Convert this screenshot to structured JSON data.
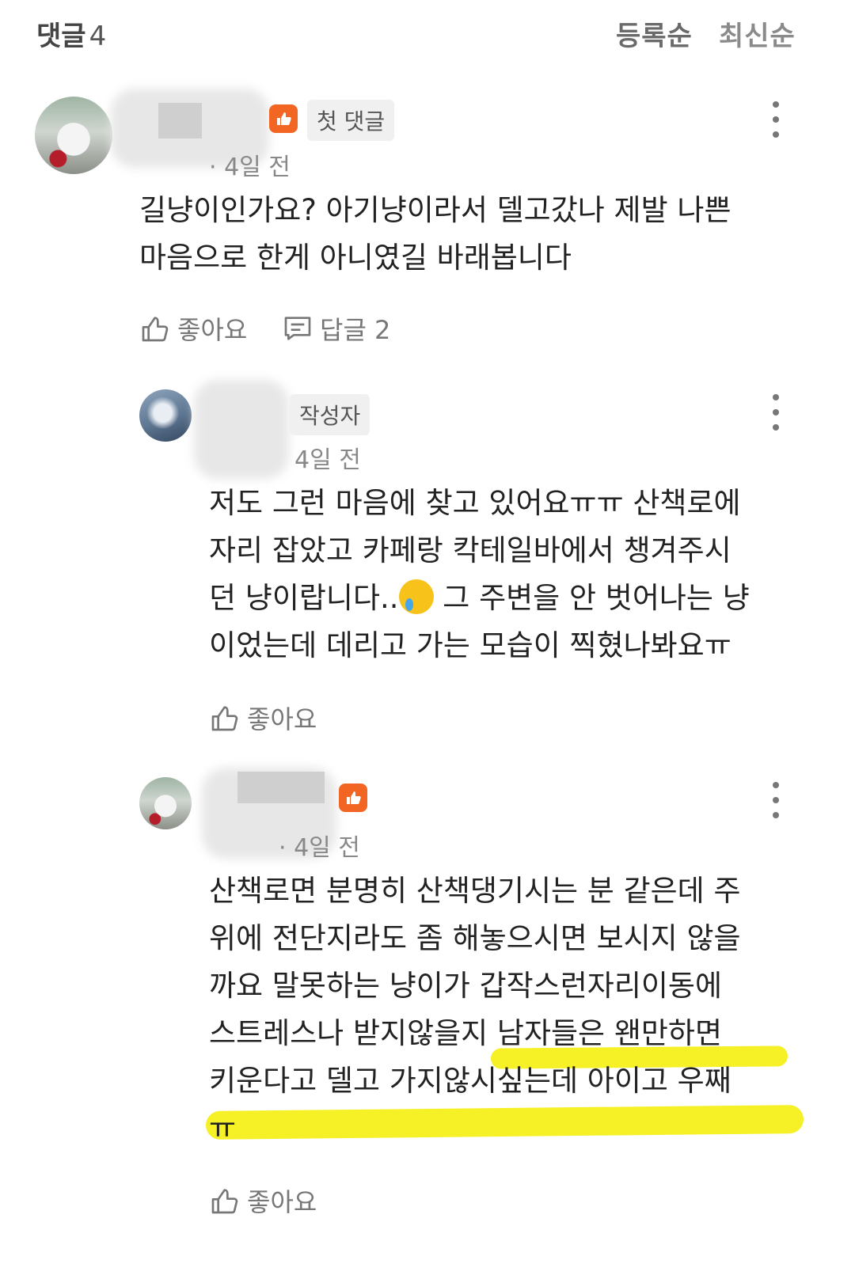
{
  "header": {
    "title": "댓글",
    "count": "4",
    "sort_options": [
      "등록순",
      "최신순"
    ]
  },
  "comments": [
    {
      "badge_tag": "첫 댓글",
      "time": "· 4일 전",
      "text_lines": [
        "길냥이인가요? 아기냥이라서 델고갔나 제발 나쁜",
        "마음으로 한게 아니였길 바래봅니다"
      ],
      "like_label": "좋아요",
      "reply_label": "답글 2"
    },
    {
      "badge_tag": "작성자",
      "time": "4일 전",
      "text_lines": [
        "저도 그런 마음에 찾고 있어요ㅠㅠ 산책로에",
        "자리 잡았고 카페랑 칵테일바에서 챙겨주시",
        "던 냥이랍니다..",
        " 그 주변을 안 벗어나는 냥",
        "이었는데 데리고 가는 모습이 찍혔나봐요ㅠ"
      ],
      "like_label": "좋아요"
    },
    {
      "time": "· 4일 전",
      "text_lines": [
        "산책로면 분명히 산책댕기시는 분 같은데 주",
        "위에 전단지라도 좀 해놓으시면 보시지 않을",
        "까요 말못하는 냥이가 갑작스런자리이동에",
        "스트레스나 받지않을지 남자들은 왠만하면",
        "키운다고 델고 가지않시싶는데 아이고 우째",
        "ㅠ"
      ],
      "like_label": "좋아요"
    }
  ],
  "icons": {
    "like": "thumbs-up-icon",
    "reply": "reply-bubble-icon",
    "more": "more-vertical-icon",
    "emoji": "crying-face-emoji",
    "badge": "thumbs-up-badge-icon"
  },
  "colors": {
    "badge": "#f26522",
    "highlight": "#f6ef1b"
  }
}
